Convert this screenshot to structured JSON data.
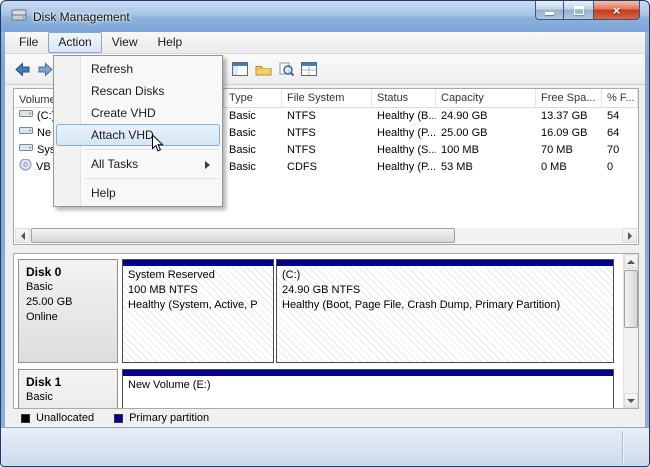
{
  "window": {
    "title": "Disk Management",
    "close_glyph": "×"
  },
  "menu_bar": {
    "items": [
      {
        "label": "File",
        "active": false
      },
      {
        "label": "Action",
        "active": true
      },
      {
        "label": "View",
        "active": false
      },
      {
        "label": "Help",
        "active": false
      }
    ]
  },
  "action_menu": {
    "items": [
      {
        "label": "Refresh",
        "state": "normal"
      },
      {
        "label": "Rescan Disks",
        "state": "normal"
      },
      {
        "label": "Create VHD",
        "state": "normal"
      },
      {
        "label": "Attach VHD",
        "state": "highlighted"
      },
      {
        "label": "All Tasks",
        "state": "normal",
        "has_submenu": true
      },
      {
        "label": "Help",
        "state": "normal"
      }
    ]
  },
  "volume_list": {
    "columns": {
      "volume": "Volume",
      "type": "Type",
      "file_system": "File System",
      "status": "Status",
      "capacity": "Capacity",
      "free_space": "Free Spa...",
      "percent_free": "% F..."
    },
    "rows": [
      {
        "volume": "(C:)",
        "type": "Basic",
        "file_system": "NTFS",
        "status": "Healthy (B...",
        "capacity": "24.90 GB",
        "free_space": "13.37 GB",
        "percent_free": "54",
        "icon": "drive-icon"
      },
      {
        "volume": "Ne",
        "type": "Basic",
        "file_system": "NTFS",
        "status": "Healthy (P...",
        "capacity": "25.00 GB",
        "free_space": "16.09 GB",
        "percent_free": "64",
        "icon": "drive-icon"
      },
      {
        "volume": "Sys",
        "type": "Basic",
        "file_system": "NTFS",
        "status": "Healthy (S...",
        "capacity": "100 MB",
        "free_space": "70 MB",
        "percent_free": "70",
        "icon": "drive-icon"
      },
      {
        "volume": "VB",
        "type": "Basic",
        "file_system": "CDFS",
        "status": "Healthy (P...",
        "capacity": "53 MB",
        "free_space": "0 MB",
        "percent_free": "0",
        "icon": "cd-icon"
      }
    ]
  },
  "disk_view": {
    "disks": [
      {
        "name": "Disk 0",
        "type": "Basic",
        "size": "25.00 GB",
        "status": "Online",
        "partitions": [
          {
            "name": "System Reserved",
            "size": "100 MB NTFS",
            "status": "Healthy (System, Active, P"
          },
          {
            "name": "(C:)",
            "size": "24.90 GB NTFS",
            "status": "Healthy (Boot, Page File, Crash Dump, Primary Partition)"
          }
        ]
      },
      {
        "name": "Disk 1",
        "type": "Basic",
        "partitions": [
          {
            "name": "New Volume (E:)"
          }
        ]
      }
    ]
  },
  "legend": {
    "items": [
      {
        "label": "Unallocated",
        "color": "#000000"
      },
      {
        "label": "Primary partition",
        "color": "#00008b"
      }
    ]
  },
  "colors": {
    "partition_strip": "#00008b",
    "menu_highlight_border": "#84acdd",
    "close_button": "#c13a1e"
  }
}
